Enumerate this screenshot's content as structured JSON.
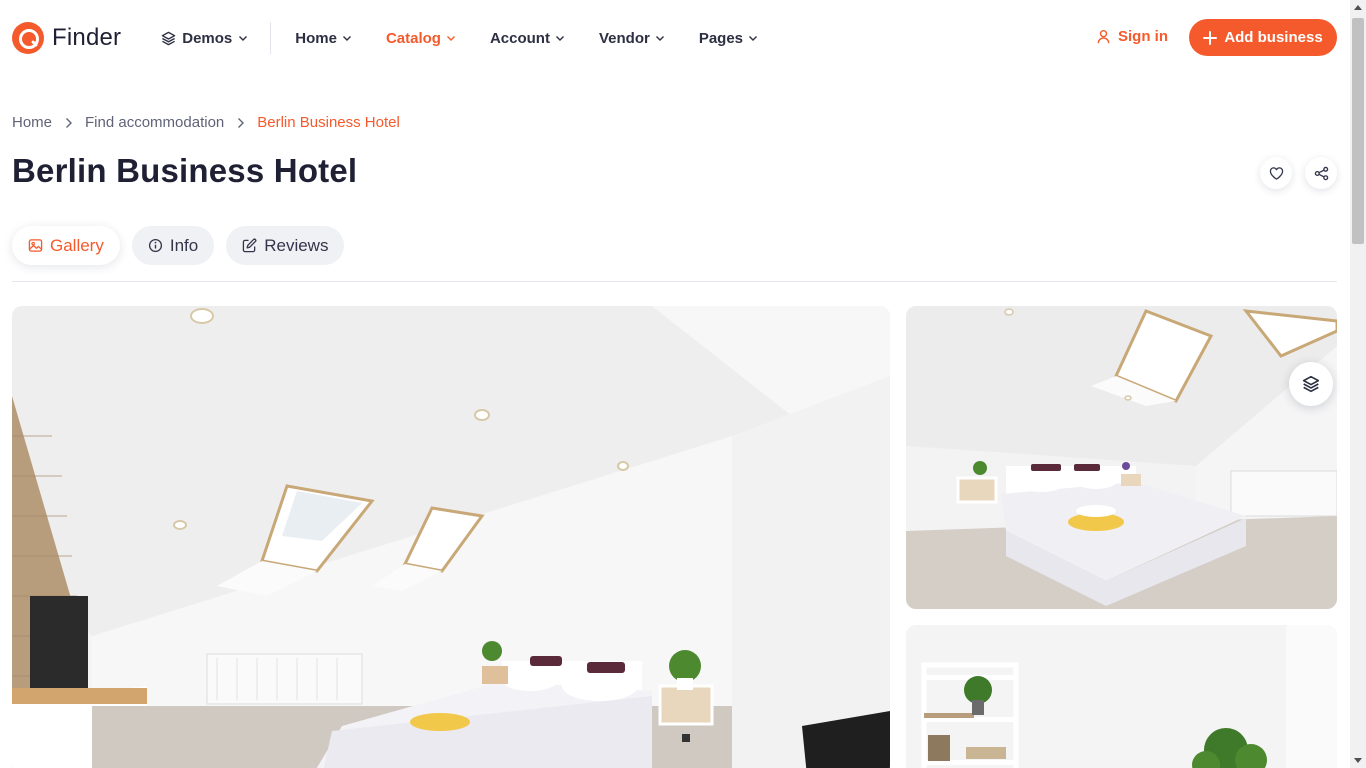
{
  "header": {
    "logo_text": "Finder",
    "nav": {
      "demos": "Demos",
      "home": "Home",
      "catalog": "Catalog",
      "account": "Account",
      "vendor": "Vendor",
      "pages": "Pages"
    },
    "sign_in": "Sign in",
    "add_business": "Add business"
  },
  "breadcrumb": {
    "home": "Home",
    "parent": "Find accommodation",
    "current": "Berlin Business Hotel"
  },
  "page": {
    "title": "Berlin Business Hotel"
  },
  "tabs": {
    "gallery": "Gallery",
    "info": "Info",
    "reviews": "Reviews"
  },
  "colors": {
    "accent": "#f55a2c",
    "text": "#1f2033",
    "muted": "#5f6378"
  },
  "icons": {
    "demos": "layers-icon",
    "chevron": "chevron-down-icon",
    "sign_in": "user-icon",
    "add": "plus-icon",
    "favorite": "heart-icon",
    "share": "share-icon",
    "gallery": "image-icon",
    "info": "info-icon",
    "reviews": "edit-icon",
    "gallery_layers": "layers-icon"
  }
}
